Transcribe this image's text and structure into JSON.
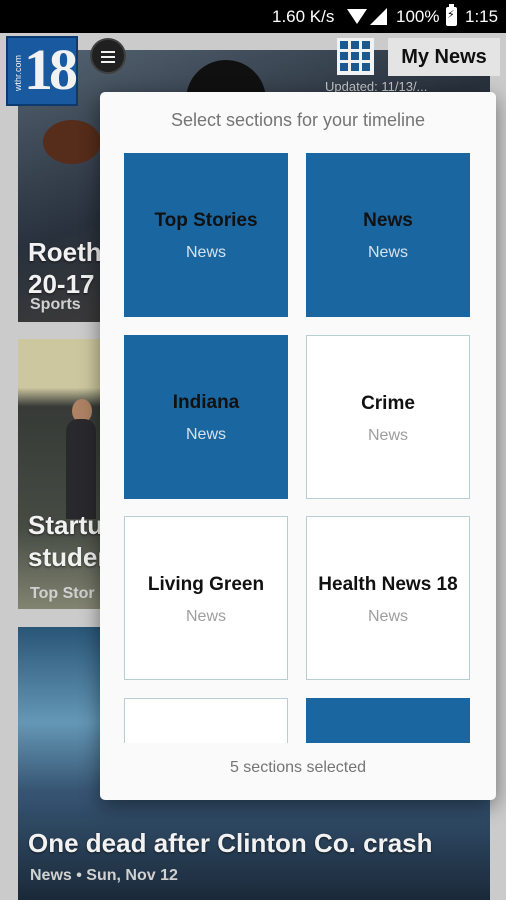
{
  "status_bar": {
    "speed": "1.60 K/s",
    "battery": "100%",
    "time": "1:15"
  },
  "header": {
    "logo_number": "18",
    "logo_site": "wthr.com",
    "my_news_label": "My News",
    "updated_text": "Updated: 11/13/..."
  },
  "feed": {
    "cards": [
      {
        "title_line1": "Roeth",
        "title_line2": "20-17",
        "meta": "Sports"
      },
      {
        "title_line1": "Startu",
        "title_line2": "studen",
        "meta": "Top Stor"
      },
      {
        "title_line1": "One dead after Clinton Co. crash",
        "meta": "News  •  Sun, Nov 12"
      }
    ]
  },
  "dialog": {
    "title": "Select sections for your timeline",
    "tiles": [
      {
        "name": "Top Stories",
        "sub": "News",
        "selected": true
      },
      {
        "name": "News",
        "sub": "News",
        "selected": true
      },
      {
        "name": "Indiana",
        "sub": "News",
        "selected": true
      },
      {
        "name": "Crime",
        "sub": "News",
        "selected": false
      },
      {
        "name": "Living Green",
        "sub": "News",
        "selected": false
      },
      {
        "name": "Health News 18",
        "sub": "News",
        "selected": false
      },
      {
        "name": "",
        "sub": "",
        "selected": false
      },
      {
        "name": "",
        "sub": "",
        "selected": true
      }
    ],
    "selected_count": "5 sections selected"
  },
  "colors": {
    "selected_tile": "#1a66a0",
    "logo_blue": "#1a5ea8"
  }
}
